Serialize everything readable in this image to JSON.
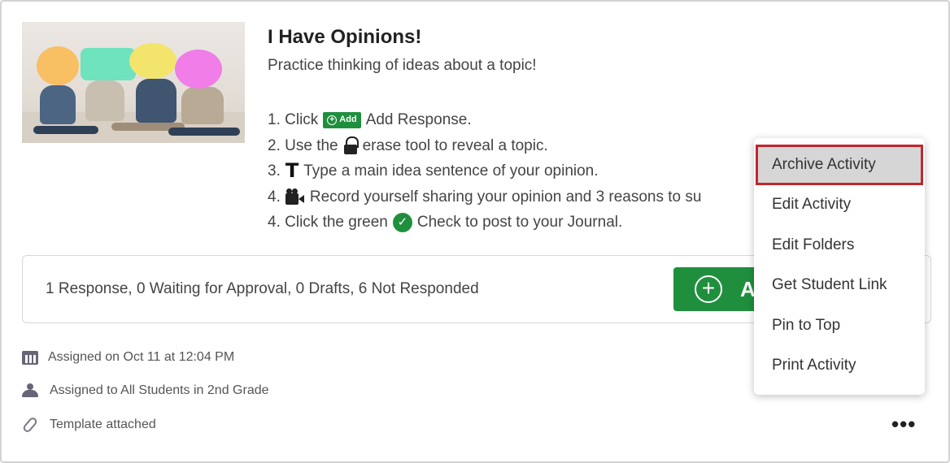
{
  "activity": {
    "title": "I Have Opinions!",
    "subtitle": "Practice thinking of ideas about a topic!",
    "steps": {
      "s1_prefix": "1. Click",
      "s1_chip": "Add",
      "s1_suffix": "Add Response.",
      "s2_prefix": "2. Use the",
      "s2_suffix": "erase tool to reveal a topic.",
      "s3_prefix": "3.",
      "s3_suffix": "Type a main idea sentence of your opinion.",
      "s4_prefix": "4.",
      "s4_suffix": "Record yourself sharing your opinion and 3 reasons to su",
      "s5_prefix": "4. Click the green",
      "s5_suffix": "Check to post to your Journal."
    }
  },
  "status": {
    "text": "1 Response, 0 Waiting for Approval, 0 Drafts, 6 Not Responded",
    "add_button_label": "A"
  },
  "meta": {
    "assigned_on": "Assigned on Oct 11 at 12:04 PM",
    "assigned_to": "Assigned to All Students in 2nd Grade",
    "template": "Template attached"
  },
  "more_button": "•••",
  "menu": {
    "items": [
      {
        "label": "Archive Activity",
        "highlighted": true
      },
      {
        "label": "Edit Activity"
      },
      {
        "label": "Edit Folders"
      },
      {
        "label": "Get Student Link"
      },
      {
        "label": "Pin to Top"
      },
      {
        "label": "Print Activity"
      }
    ]
  },
  "colors": {
    "brand_green": "#1f8f3e",
    "highlight_outline": "#c1272d",
    "bubble_orange": "#f8bf63",
    "bubble_mint": "#6fe3bd",
    "bubble_yellow": "#f3e46b",
    "bubble_pink": "#f07de8"
  },
  "icons": {
    "thumbnail": "activity-thumbnail-image",
    "add_chip": "plus-circle-icon",
    "erase": "lock-icon",
    "type": "text-t-icon",
    "record": "video-camera-icon",
    "check": "check-circle-icon",
    "add_button": "plus-circle-icon",
    "calendar": "calendar-icon",
    "users": "users-icon",
    "attachment": "paperclip-icon",
    "more": "more-horizontal-icon"
  }
}
